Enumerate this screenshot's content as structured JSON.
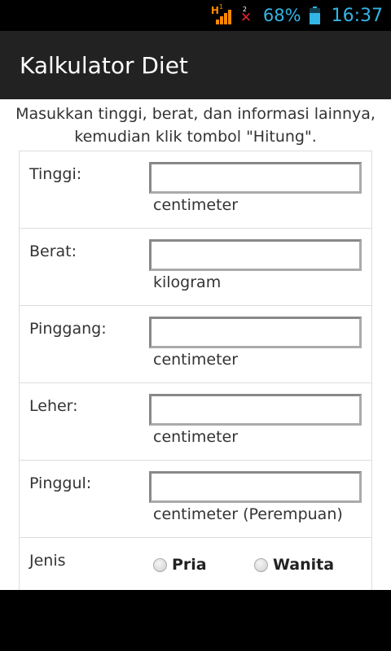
{
  "status_bar": {
    "network_label": "H",
    "sim1": "1",
    "sim2": "2",
    "battery_percent": "68%",
    "battery_level": 0.68,
    "time": "16:37",
    "colors": {
      "accent": "#33b5e5",
      "signal": "#ff8800",
      "no_signal": "#d9262e"
    }
  },
  "action_bar": {
    "title": "Kalkulator Diet"
  },
  "instructions": "Masukkan tinggi, berat, dan informasi lainnya, kemudian klik tombol \"Hitung\".",
  "form": {
    "fields": [
      {
        "label": "Tinggi:",
        "value": "",
        "placeholder": "",
        "unit": "centimeter"
      },
      {
        "label": "Berat:",
        "value": "",
        "placeholder": "",
        "unit": "kilogram"
      },
      {
        "label": "Pinggang:",
        "value": "",
        "placeholder": "",
        "unit": "centimeter"
      },
      {
        "label": "Leher:",
        "value": "",
        "placeholder": "",
        "unit": "centimeter"
      },
      {
        "label": "Pinggul:",
        "value": "",
        "placeholder": "",
        "unit": "centimeter (Perempuan)"
      }
    ],
    "gender": {
      "label": "Jenis",
      "options": [
        {
          "label": "Pria",
          "selected": false
        },
        {
          "label": "Wanita",
          "selected": false
        }
      ]
    }
  }
}
